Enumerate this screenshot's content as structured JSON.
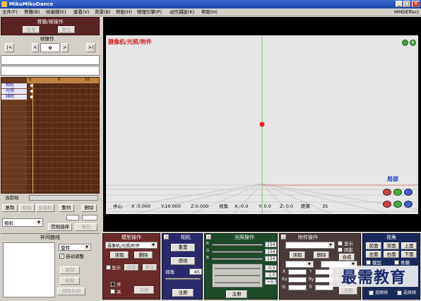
{
  "titlebar": {
    "title": "MikuMikuDance"
  },
  "menu": {
    "items": [
      "文件(F)",
      "骨骼(B)",
      "帧编辑(E)",
      "查看(V)",
      "背景(B)",
      "帮助(H)",
      "物理引擎(P)",
      "动作捕捉(K)",
      "帮助(H)"
    ],
    "right_label": "MMDEffect"
  },
  "bone_panel": {
    "title": "骨骼/帧操作",
    "btn_register": "登录",
    "btn_reset": "复位"
  },
  "frame_panel": {
    "title": "帧操作",
    "btn_first": "|<",
    "btn_prev": "<",
    "frame_value": "0",
    "btn_next": ">",
    "btn_last": ">|"
  },
  "timeline": {
    "ruler": [
      "0",
      "5",
      "10"
    ],
    "rows": [
      "相机",
      "光照",
      "辅助"
    ]
  },
  "left_bottom": {
    "current_frame_label": "当前帧",
    "btn_copy": "复制",
    "btn_paste": "粘贴",
    "btn_reverse_paste": "反粘贴",
    "btn_align": "整列",
    "btn_delete": "删除",
    "model_select": "相机",
    "btn_range_select": "范围选择",
    "btn_extra": "复位"
  },
  "viewport": {
    "mode_label": "摄像机/光照/附件",
    "local_label": "局部",
    "status": {
      "center": "中心",
      "x": "X :0.000",
      "y": "Y:10.000",
      "z": "Z:0.000",
      "view": "视角",
      "rx": "X:-0.0",
      "ry": "Y: 0.0",
      "rz": "Z: 0.0",
      "distance": "距离",
      "distance_value": "35"
    }
  },
  "interp_panel": {
    "title": "补间曲线",
    "select": "旋转",
    "auto_label": "自动调整",
    "btn_copy": "复制",
    "btn_paste": "粘贴",
    "btn_linear": "线性补间"
  },
  "model_panel": {
    "title": "模型操作",
    "select": "摄像机/光照/附件",
    "btn_load": "读取",
    "btn_delete": "删除",
    "show_label": "显示",
    "btn_a": "选择",
    "btn_b": "复位",
    "on_label": "开",
    "off_label": "关",
    "btn_register": "注册"
  },
  "camera_panel": {
    "title": "相机",
    "btn_reset": "重置",
    "btn_perspective": "透视",
    "fov_label": "视角",
    "fov_value": "45",
    "btn_register": "注册"
  },
  "light_panel": {
    "title": "光照操作",
    "r_label": "R",
    "g_label": "G",
    "b_label": "B",
    "r_value": "154",
    "g_value": "154",
    "b_value": "154",
    "x_value": "-0.5",
    "y_value": "-1.0",
    "z_value": "+0.5",
    "btn_register": "注册"
  },
  "accessory_panel": {
    "title": "附件操作",
    "btn_load": "读取",
    "btn_delete": "删除",
    "show_label": "显示",
    "shadow_label": "阴影",
    "btn_combine": "合成",
    "fields": [
      "X",
      "Y",
      "Z",
      "Rx",
      "Ry",
      "Rz",
      "Si",
      "Tr"
    ],
    "btn_register": "注册"
  },
  "view_panel": {
    "title": "视角",
    "btn_front": "前面",
    "btn_back": "背面",
    "btn_top": "上面",
    "btn_left": "左面",
    "btn_right": "右面",
    "btn_bottom": "下面",
    "model_label": "模型",
    "bone_label": "骨骼",
    "track_label": "追随帧",
    "sel_label": "选择帧"
  },
  "watermark": "最需教育",
  "colors": {
    "bone_panel": "#5a2424",
    "model_panel": "#6a2a2a",
    "camera_panel": "#2a2a6a",
    "light_panel": "#1e4a2a",
    "accessory_panel": "#4a3a3a",
    "view_panel": "#1a2a5a",
    "viewport_bg": "#e6e6e6",
    "mode_text": "#d02020",
    "local_text": "#2040c0"
  }
}
